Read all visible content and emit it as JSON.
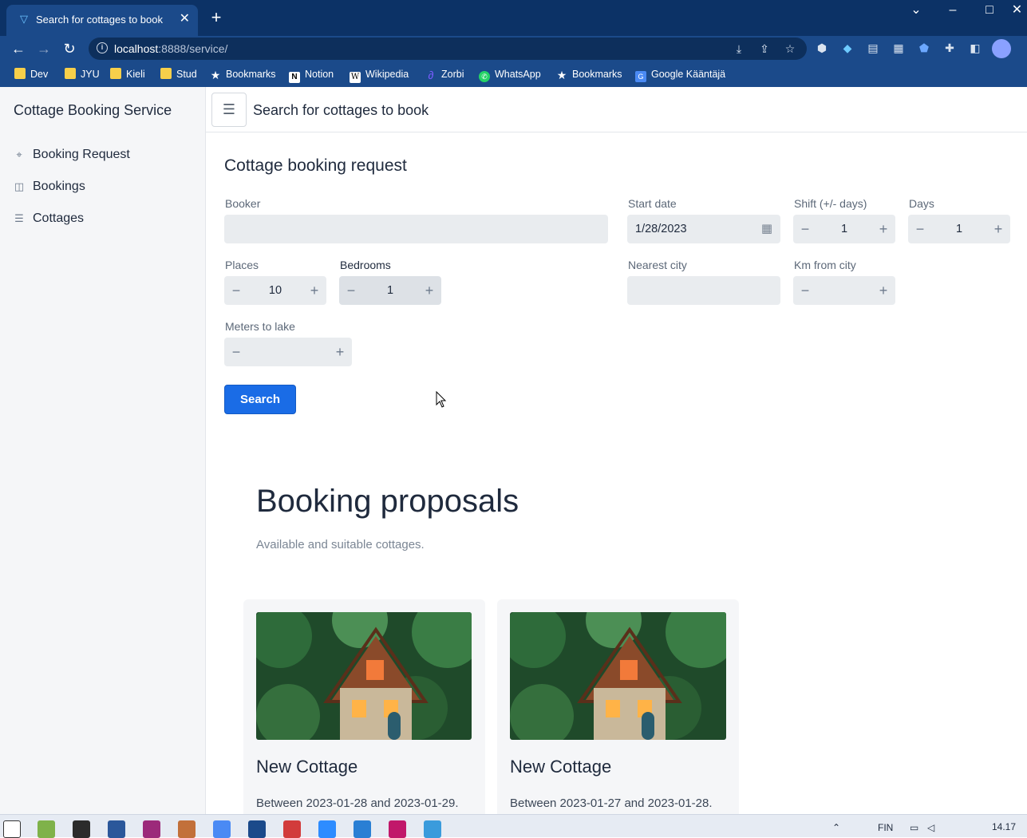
{
  "browser": {
    "tab_title": "Search for cottages to book",
    "tab_close": "✕",
    "new_tab": "+",
    "url_host": "localhost",
    "url_rest": ":8888/service/",
    "bookmarks": [
      "Dev",
      "JYU",
      "Kieli",
      "Stud",
      "Bookmarks",
      "Notion",
      "Wikipedia",
      "Zorbi",
      "WhatsApp",
      "Bookmarks",
      "Google Kääntäjä"
    ]
  },
  "app": {
    "brand": "Cottage Booking Service",
    "nav": [
      {
        "label": "Booking Request",
        "icon": "map-pin-icon"
      },
      {
        "label": "Bookings",
        "icon": "columns-icon"
      },
      {
        "label": "Cottages",
        "icon": "list-icon"
      }
    ],
    "header_title": "Search for cottages to book",
    "form": {
      "heading": "Cottage booking request",
      "booker_label": "Booker",
      "booker_value": "",
      "start_date_label": "Start date",
      "start_date_value": "1/28/2023",
      "shift_label": "Shift (+/- days)",
      "shift_value": "1",
      "days_label": "Days",
      "days_value": "1",
      "places_label": "Places",
      "places_value": "10",
      "bedrooms_label": "Bedrooms",
      "bedrooms_value": "1",
      "nearest_city_label": "Nearest city",
      "nearest_city_value": "",
      "km_label": "Km from city",
      "km_value": "",
      "meters_label": "Meters to lake",
      "meters_value": "",
      "search_button": "Search"
    },
    "proposals": {
      "heading": "Booking proposals",
      "subtitle": "Available and suitable cottages.",
      "cards": [
        {
          "title": "New Cottage",
          "desc": "Between 2023-01-28 and 2023-01-29."
        },
        {
          "title": "New Cottage",
          "desc": "Between 2023-01-27 and 2023-01-28."
        }
      ]
    }
  },
  "system": {
    "lang": "FIN",
    "time": "14.17"
  },
  "colors": {
    "accent": "#1a6ce6",
    "chrome": "#1b4a8a",
    "tabbar": "#0c3266"
  }
}
